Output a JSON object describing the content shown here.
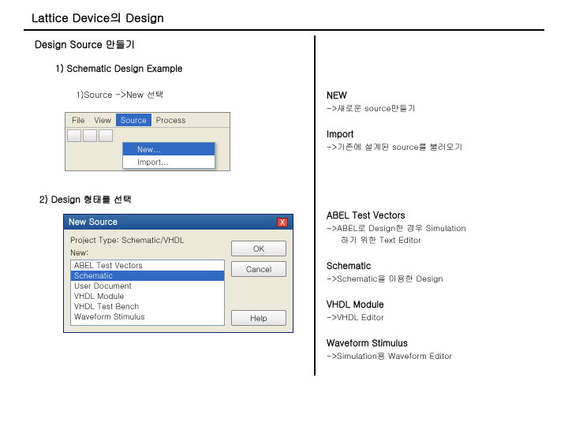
{
  "title": "Lattice Device의 Design",
  "left": {
    "heading": "Design Source 만들기",
    "section1_heading": "1) Schematic Design Example",
    "step1": "1)Source ->New 선택",
    "section2_heading": "2) Design 형태를 선택"
  },
  "toolbar": {
    "menu_file": "File",
    "menu_view": "View",
    "menu_source": "Source",
    "menu_process": "Process",
    "dropdown_new": "New...",
    "dropdown_import": "Import..."
  },
  "dialog": {
    "title": "New Source",
    "label": "Project Type: Schematic/VHDL",
    "new_label": "New:",
    "options": {
      "abel": "ABEL Test Vectors",
      "schematic": "Schematic",
      "user_doc": "User Document",
      "vhdl_module": "VHDL Module",
      "vhdl_tb": "VHDL Test Bench",
      "waveform": "Waveform Stimulus"
    },
    "btn_ok": "OK",
    "btn_cancel": "Cancel",
    "btn_help": "Help",
    "close_x": "X"
  },
  "right": {
    "new_hd": "NEW",
    "new_desc": "->새로운 source만들기",
    "import_hd": "Import",
    "import_desc": "->기존에 설계된 source를 불러오기",
    "abel_hd": "ABEL Test Vectors",
    "abel_desc1": "->ABEL로 Design한 경우 Simulation",
    "abel_desc2": "하기 위한 Text Editor",
    "schem_hd": "Schematic",
    "schem_desc": "->Schematic을 이용한 Design",
    "vhdl_hd": "VHDL Module",
    "vhdl_desc": "->VHDL Editor",
    "wave_hd": "Waveform Stimulus",
    "wave_desc": "->Simulation용 Waveform Editor"
  }
}
